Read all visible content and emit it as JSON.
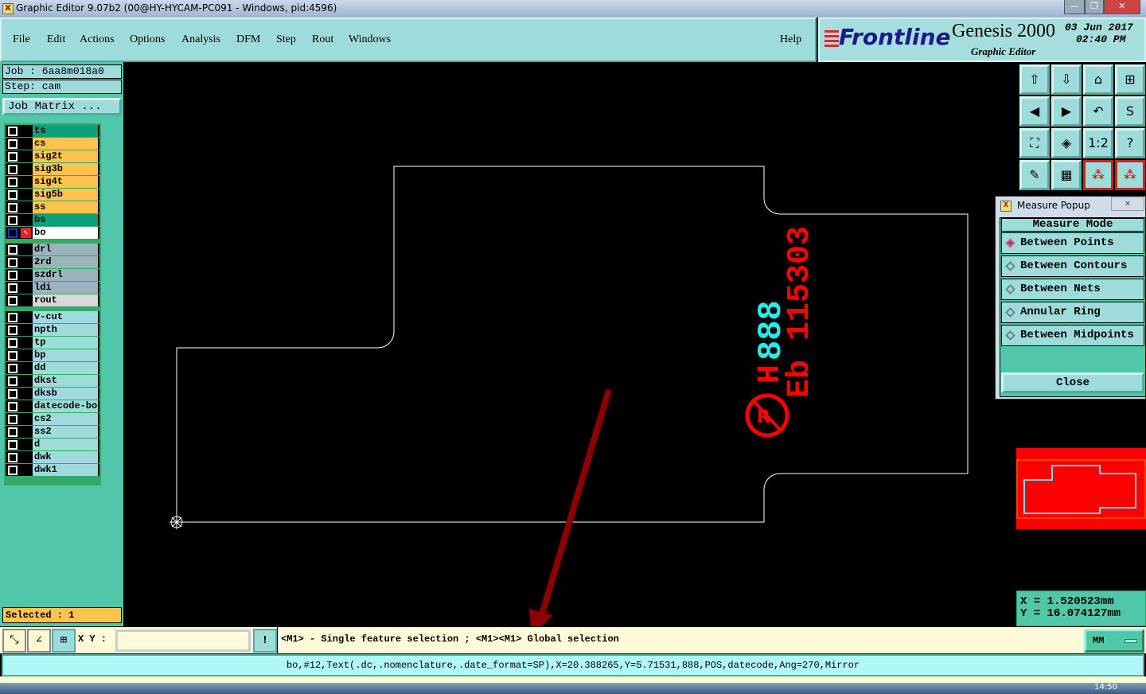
{
  "window": {
    "title": "Graphic Editor 9.07b2 (00@HY-HYCAM-PC091 - Windows, pid:4596)"
  },
  "menu": {
    "items": [
      "File",
      "Edit",
      "Actions",
      "Options",
      "Analysis",
      "DFM",
      "Step",
      "Rout",
      "Windows"
    ],
    "help": "Help"
  },
  "brand": {
    "logo": "Frontline",
    "product": "Genesis 2000",
    "subtitle": "Graphic Editor",
    "date": "03 Jun 2017",
    "time": "02:40 PM"
  },
  "job": {
    "job": "Job  :  6aa8m018a0",
    "step": "Step: cam",
    "matrix_button": "Job Matrix ..."
  },
  "layers": {
    "group1": [
      {
        "name": "ts",
        "color": "#0aa07a"
      },
      {
        "name": "cs",
        "color": "#fdc34f"
      },
      {
        "name": "sig2t",
        "color": "#fdc34f"
      },
      {
        "name": "sig3b",
        "color": "#fdc34f"
      },
      {
        "name": "sig4t",
        "color": "#fdc34f"
      },
      {
        "name": "sig5b",
        "color": "#fdc34f"
      },
      {
        "name": "ss",
        "color": "#fdc34f"
      },
      {
        "name": "bs",
        "color": "#0aa07a"
      },
      {
        "name": "bo",
        "color": "#ffffff",
        "active": true
      }
    ],
    "group2": [
      {
        "name": "drl",
        "color": "#9ab4bc"
      },
      {
        "name": "2rd",
        "color": "#9ab4bc"
      },
      {
        "name": "szdrl",
        "color": "#9ab4bc"
      },
      {
        "name": "ldi",
        "color": "#9ab4bc"
      },
      {
        "name": "rout",
        "color": "#d8d8d8"
      }
    ],
    "group3": [
      "v-cut",
      "npth",
      "tp",
      "bp",
      "dd",
      "dkst",
      "dksb",
      "datecode-bo",
      "cs2",
      "ss2",
      "d",
      "dwk",
      "dwk1"
    ]
  },
  "selected": "Selected : 1",
  "canvas": {
    "text_red_line1": "Eb 115303",
    "text_red_h": "H",
    "text_cyan": "888",
    "board_color": "#ffffff",
    "arrow_color": "#8b0000"
  },
  "popup": {
    "title": "Measure Popup",
    "header": "Measure Mode",
    "options": [
      "Between Points",
      "Between Contours",
      "Between Nets",
      "Annular Ring",
      "Between Midpoints"
    ],
    "selected": 0,
    "close": "Close"
  },
  "coords": {
    "x": "X  =  1.520523mm",
    "y": "Y  =  16.074127mm"
  },
  "bottom": {
    "xy_label": "X Y :",
    "xy_value": "",
    "hint": "<M1> - Single feature selection ; <M1><M1> Global selection",
    "units": "MM"
  },
  "status": "bo,#12,Text(.dc,.nomenclature,.date_format=SP),X=20.388265,Y=5.71531,888,POS,datecode,Ang=270,Mirror",
  "taskbar": {
    "clock": "14:50"
  }
}
